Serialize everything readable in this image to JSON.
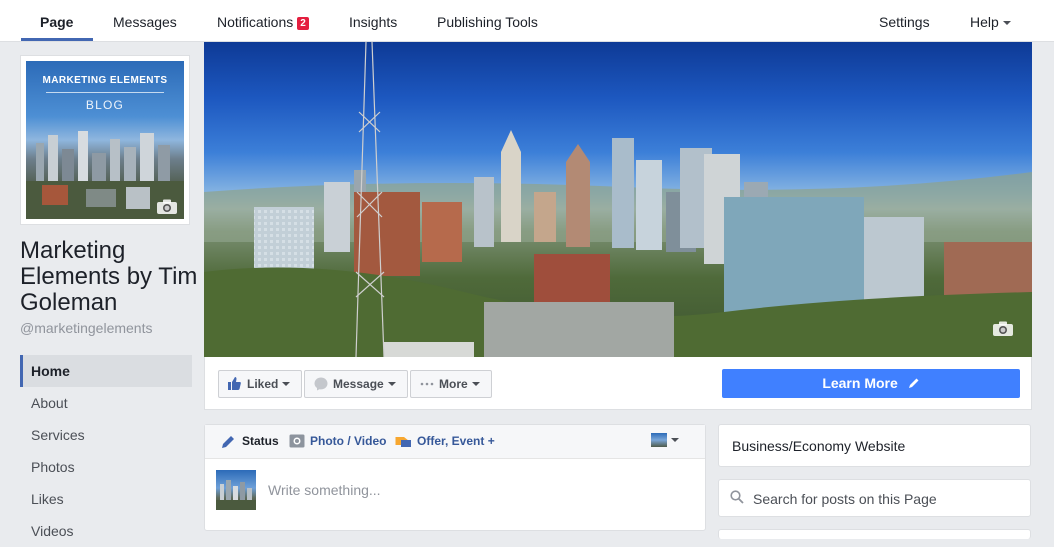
{
  "tabs": [
    {
      "label": "Page"
    },
    {
      "label": "Messages"
    },
    {
      "label": "Notifications",
      "badge": "2"
    },
    {
      "label": "Insights"
    },
    {
      "label": "Publishing Tools"
    },
    {
      "label": "Settings"
    },
    {
      "label": "Help"
    }
  ],
  "profile": {
    "title": "MARKETING ELEMENTS",
    "subtitle": "BLOG"
  },
  "page": {
    "name": "Marketing Elements by Tim Goleman",
    "handle": "@marketingelements"
  },
  "left_nav": [
    {
      "label": "Home"
    },
    {
      "label": "About"
    },
    {
      "label": "Services"
    },
    {
      "label": "Photos"
    },
    {
      "label": "Likes"
    },
    {
      "label": "Videos"
    }
  ],
  "actions": {
    "liked": "Liked",
    "message": "Message",
    "more": "More",
    "learn_more": "Learn More"
  },
  "composer": {
    "status": "Status",
    "photo_video": "Photo / Video",
    "offer_event": "Offer, Event +",
    "placeholder": "Write something..."
  },
  "sidebar": {
    "category": "Business/Economy Website",
    "search_placeholder": "Search for posts on this Page"
  },
  "colors": {
    "accent": "#4267b2",
    "learn_more": "#4080ff",
    "badge": "#e41e3f"
  }
}
